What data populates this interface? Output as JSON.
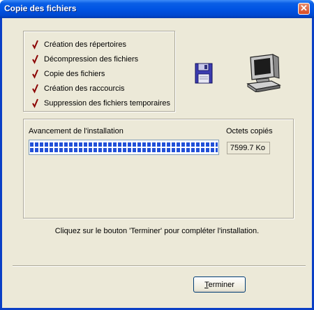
{
  "window": {
    "title": "Copie des fichiers"
  },
  "steps": [
    {
      "label": "Création des répertoires",
      "done": true
    },
    {
      "label": "Décompression des fichiers",
      "done": true
    },
    {
      "label": "Copie des fichiers",
      "done": true
    },
    {
      "label": "Création des raccourcis",
      "done": true
    },
    {
      "label": "Suppression des fichiers temporaires",
      "done": true
    }
  ],
  "icons": [
    "floppy-disk-icon",
    "computer-icon",
    "check-icon",
    "close-icon"
  ],
  "progress": {
    "label": "Avancement de l'installation",
    "percent": 100,
    "bytes_label": "Octets copiés",
    "bytes_value": "7599.7 Ko"
  },
  "message": "Cliquez sur le bouton 'Terminer' pour compléter l'installation.",
  "buttons": {
    "finish_prefix": "T",
    "finish_rest": "erminer"
  },
  "colors": {
    "titlebar": "#0054e3",
    "window_bg": "#ece9d8",
    "check": "#8b0000",
    "progress": "#2150d8"
  }
}
